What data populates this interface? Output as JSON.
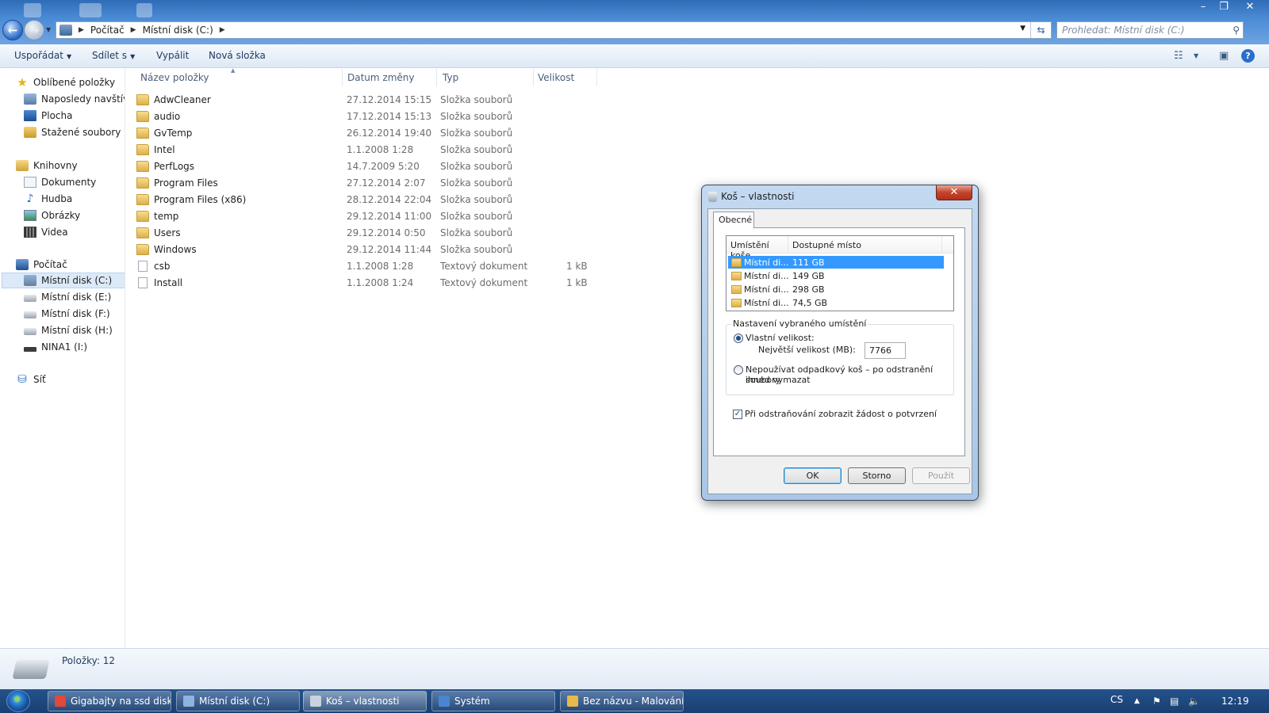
{
  "window": {
    "breadcrumb": [
      "Počítač",
      "Místní disk (C:)"
    ],
    "search_placeholder": "Prohledat: Místní disk (C:)",
    "controls": [
      "–",
      "❐",
      "✕"
    ]
  },
  "toolbar": {
    "organize": "Uspořádat",
    "share": "Sdílet s",
    "burn": "Vypálit",
    "new_folder": "Nová složka"
  },
  "navpane": {
    "favorites": "Oblíbené položky",
    "recent": "Naposledy navštívené",
    "desktop": "Plocha",
    "downloads": "Stažené soubory",
    "libraries": "Knihovny",
    "documents": "Dokumenty",
    "music": "Hudba",
    "pictures": "Obrázky",
    "videos": "Videa",
    "computer": "Počítač",
    "drive_c": "Místní disk (C:)",
    "drive_e": "Místní disk (E:)",
    "drive_f": "Místní disk (F:)",
    "drive_h": "Místní disk (H:)",
    "drive_i": "NINA1 (I:)",
    "network": "Síť"
  },
  "columns": {
    "name": "Název položky",
    "date": "Datum změny",
    "type": "Typ",
    "size": "Velikost"
  },
  "files": [
    {
      "name": "AdwCleaner",
      "date": "27.12.2014 15:15",
      "type": "Složka souborů",
      "size": ""
    },
    {
      "name": "audio",
      "date": "17.12.2014 15:13",
      "type": "Složka souborů",
      "size": ""
    },
    {
      "name": "GvTemp",
      "date": "26.12.2014 19:40",
      "type": "Složka souborů",
      "size": ""
    },
    {
      "name": "Intel",
      "date": "1.1.2008 1:28",
      "type": "Složka souborů",
      "size": ""
    },
    {
      "name": "PerfLogs",
      "date": "14.7.2009 5:20",
      "type": "Složka souborů",
      "size": ""
    },
    {
      "name": "Program Files",
      "date": "27.12.2014 2:07",
      "type": "Složka souborů",
      "size": ""
    },
    {
      "name": "Program Files (x86)",
      "date": "28.12.2014 22:04",
      "type": "Složka souborů",
      "size": ""
    },
    {
      "name": "temp",
      "date": "29.12.2014 11:00",
      "type": "Složka souborů",
      "size": ""
    },
    {
      "name": "Users",
      "date": "29.12.2014 0:50",
      "type": "Složka souborů",
      "size": ""
    },
    {
      "name": "Windows",
      "date": "29.12.2014 11:44",
      "type": "Složka souborů",
      "size": ""
    },
    {
      "name": "csb",
      "date": "1.1.2008 1:28",
      "type": "Textový dokument",
      "size": "1 kB"
    },
    {
      "name": "Install",
      "date": "1.1.2008 1:24",
      "type": "Textový dokument",
      "size": "1 kB"
    }
  ],
  "status": {
    "items": "Položky: 12"
  },
  "dialog": {
    "title": "Koš – vlastnosti",
    "close": "✕",
    "tab": "Obecné",
    "col_location": "Umístění koše",
    "col_space": "Dostupné místo",
    "locations": [
      {
        "name": "Místní di...",
        "space": "111 GB"
      },
      {
        "name": "Místní di...",
        "space": "149 GB"
      },
      {
        "name": "Místní di...",
        "space": "298 GB"
      },
      {
        "name": "Místní di...",
        "space": "74,5 GB"
      }
    ],
    "group_label": "Nastavení vybraného umístění",
    "custom_size": "Vlastní velikost:",
    "max_size_label": "Největší velikost (MB):",
    "max_size_value": "7766",
    "no_recycle_line1": "Nepoužívat odpadkový koš – po odstranění soubory",
    "no_recycle_line2": "ihned vymazat",
    "confirm_label": "Při odstraňování zobrazit žádost o potvrzení",
    "ok": "OK",
    "cancel": "Storno",
    "apply": "Použít"
  },
  "taskbar": {
    "tasks": [
      {
        "label": "Gigabajty na ssd disk...",
        "icon_color": "#e2483b"
      },
      {
        "label": "Místní disk (C:)",
        "icon_color": "#8cb4df"
      },
      {
        "label": "Koš – vlastnosti",
        "icon_color": "#c9d3de"
      },
      {
        "label": "Systém",
        "icon_color": "#4a86cf"
      },
      {
        "label": "Bez názvu - Malování",
        "icon_color": "#e9b84a"
      }
    ],
    "lang": "CS",
    "clock": "12:19"
  }
}
